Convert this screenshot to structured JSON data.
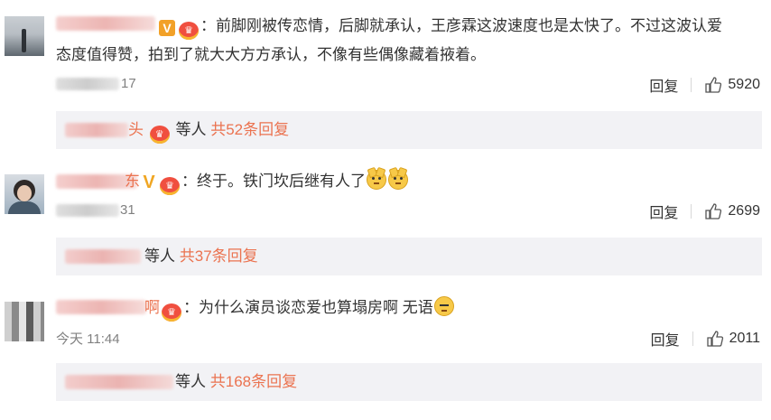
{
  "comments": [
    {
      "text_line1": "：前脚刚被传恋情，后脚就承认，王彦霖这波速度也是太快了。不过这波认爱",
      "text_line2": "态度值得赞，拍到了就大大方方承认，不像有些偶像藏着掖着。",
      "time": "17",
      "reply_label": "回复",
      "likes": "5920",
      "replies": {
        "suffix": "等人",
        "count_text": "共52条回复"
      }
    },
    {
      "text": "：终于。铁门坎后继有人了",
      "time": "31",
      "reply_label": "回复",
      "likes": "2699",
      "replies": {
        "suffix": "等人",
        "count_text": "共37条回复"
      }
    },
    {
      "name_visible": "啊",
      "text": "：为什么演员谈恋爱也算塌房啊 无语",
      "time": "今天 11:44",
      "reply_label": "回复",
      "likes": "2011",
      "replies": {
        "suffix": "等人",
        "count_text": "共168条回复"
      }
    }
  ],
  "partial_names": {
    "c1_reply_head": "头",
    "c2_name_tail": "东"
  },
  "icons": {
    "verified": "V",
    "crown": "♛",
    "like": "thumb-up-icon"
  },
  "colors": {
    "accent": "#eb7350",
    "reply_bg": "#f2f2f5",
    "muted": "#808080"
  }
}
